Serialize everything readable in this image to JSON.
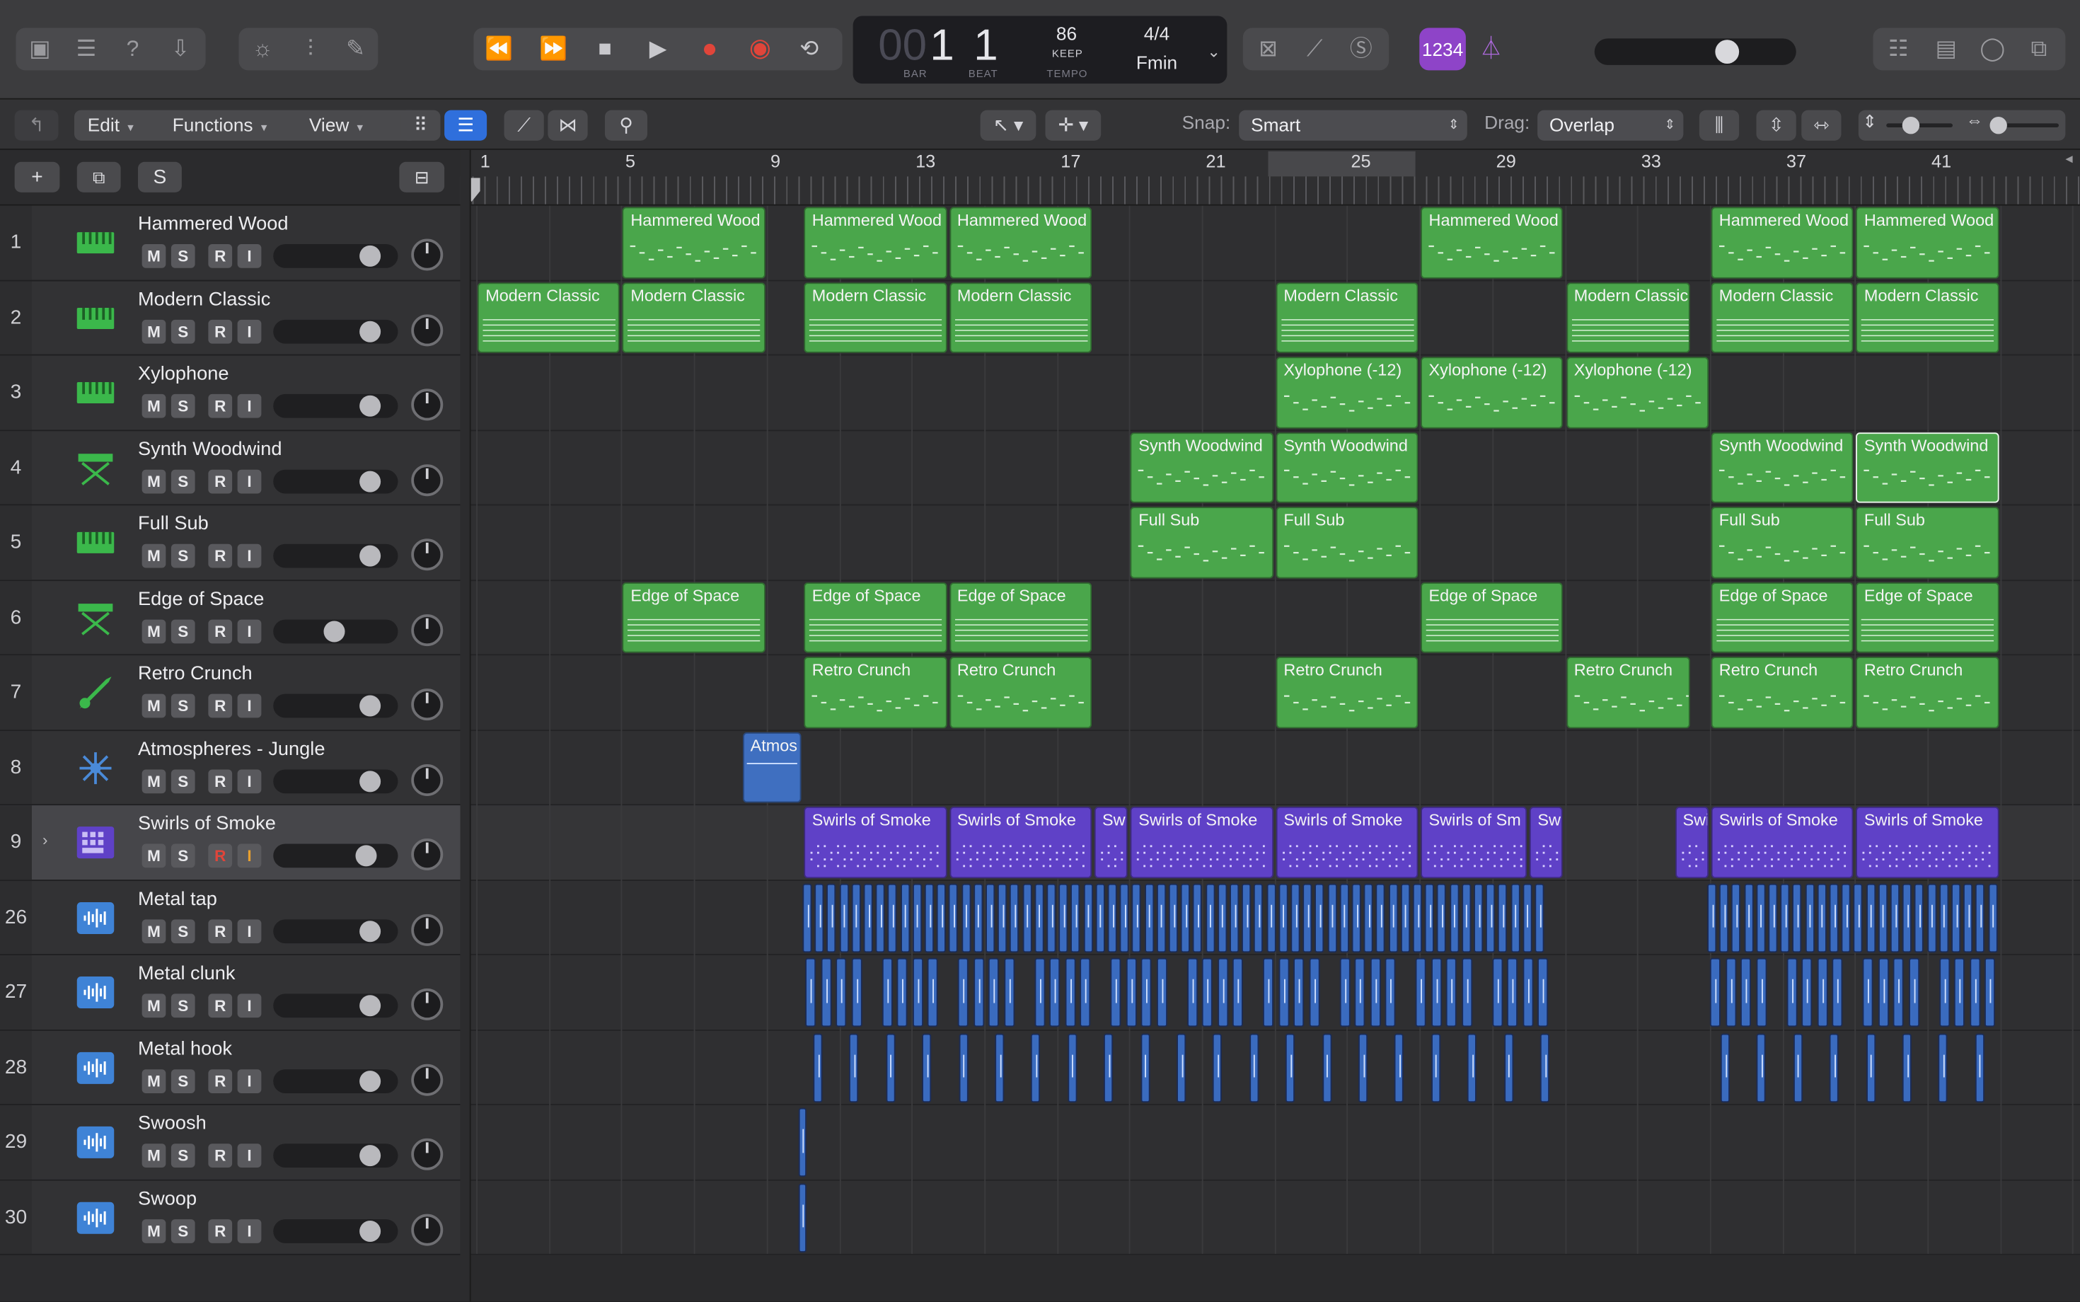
{
  "transport": {
    "bar_dim": "00",
    "bar": "1",
    "beat": "1",
    "bar_label": "BAR",
    "beat_label": "BEAT",
    "tempo": "86",
    "tempo_mode": "KEEP",
    "tempo_label": "TEMPO",
    "signature": "4/4",
    "key": "Fmin",
    "count_in": "1234"
  },
  "toolbar": {
    "edit": "Edit",
    "functions": "Functions",
    "view": "View",
    "snap_label": "Snap:",
    "snap_value": "Smart",
    "drag_label": "Drag:",
    "drag_value": "Overlap"
  },
  "header": {
    "add": "+",
    "solo_label": "S"
  },
  "ruler": [
    "1",
    "5",
    "9",
    "13",
    "17",
    "21",
    "25",
    "29",
    "33",
    "37",
    "41"
  ],
  "tracks": [
    {
      "num": "1",
      "name": "Hammered Wood"
    },
    {
      "num": "2",
      "name": "Modern Classic"
    },
    {
      "num": "3",
      "name": "Xylophone"
    },
    {
      "num": "4",
      "name": "Synth Woodwind"
    },
    {
      "num": "5",
      "name": "Full Sub"
    },
    {
      "num": "6",
      "name": "Edge of Space"
    },
    {
      "num": "7",
      "name": "Retro Crunch"
    },
    {
      "num": "8",
      "name": "Atmospheres - Jungle"
    },
    {
      "num": "9",
      "name": "Swirls of Smoke"
    },
    {
      "num": "26",
      "name": "Metal tap"
    },
    {
      "num": "27",
      "name": "Metal clunk"
    },
    {
      "num": "28",
      "name": "Metal hook"
    },
    {
      "num": "29",
      "name": "Swoosh"
    },
    {
      "num": "30",
      "name": "Swoop"
    }
  ],
  "buttons": {
    "mute": "M",
    "solo": "S",
    "record": "R",
    "input": "I"
  },
  "regions": {
    "hammered": "Hammered Wood",
    "modern": "Modern Classic",
    "xylo": "Xylophone (-12)",
    "synth": "Synth Woodwind",
    "fullsub": "Full Sub",
    "edge": "Edge of Space",
    "retro": "Retro Crunch",
    "atmos": "Atmos",
    "swirls": "Swirls of Smoke",
    "swirls_sm": "Swirls of Sm",
    "swi": "Swi"
  },
  "colors": {
    "midi_region": "#4aa64b",
    "drummer_region": "#5f41c7",
    "audio_region": "#3f6fc0",
    "record": "#e0453a",
    "count_in": "#8e44c8"
  }
}
